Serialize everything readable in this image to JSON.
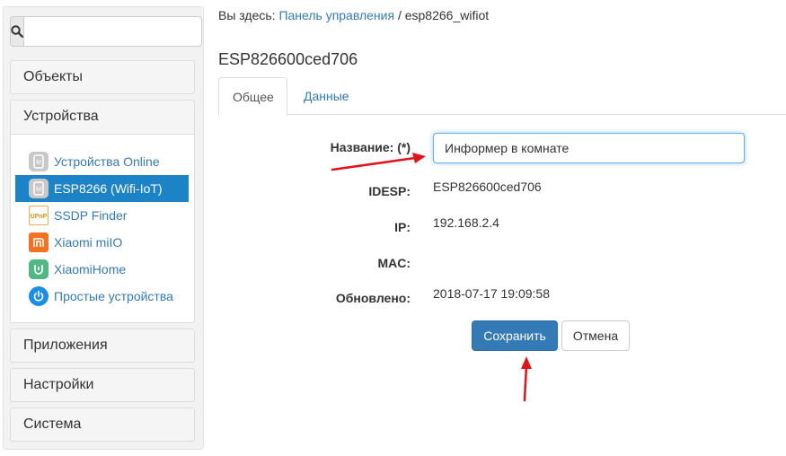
{
  "sidebar": {
    "search": {
      "placeholder": "",
      "value": ""
    },
    "panels": {
      "objects": "Объекты",
      "devices": "Устройства",
      "apps": "Приложения",
      "settings": "Настройки",
      "system": "Система"
    },
    "device_items": [
      {
        "label": "Устройства Online",
        "icon": "device-icon",
        "active": false
      },
      {
        "label": "ESP8266 (Wifi-IoT)",
        "icon": "device-icon",
        "active": true
      },
      {
        "label": "SSDP Finder",
        "icon": "upnp-icon",
        "active": false
      },
      {
        "label": "Xiaomi miIO",
        "icon": "mi-icon",
        "active": false
      },
      {
        "label": "XiaomiHome",
        "icon": "xiaomi-home-icon",
        "active": false
      },
      {
        "label": "Простые устройства",
        "icon": "power-icon",
        "active": false
      }
    ]
  },
  "breadcrumb": {
    "prefix": "Вы здесь: ",
    "link": "Панель управления",
    "separator": " / ",
    "current": "esp8266_wifiot"
  },
  "page_title": "ESP826600ced706",
  "tabs": {
    "general": "Общее",
    "data": "Данные"
  },
  "form": {
    "name_label": "Название: (*)",
    "name_value": "Информер в комнате",
    "idesp_label": "IDESP:",
    "idesp_value": "ESP826600ced706",
    "ip_label": "IP:",
    "ip_value": "192.168.2.4",
    "mac_label": "MAC:",
    "mac_value": "",
    "updated_label": "Обновлено:",
    "updated_value": "2018-07-17 19:09:58"
  },
  "buttons": {
    "save": "Сохранить",
    "cancel": "Отмена"
  },
  "colors": {
    "accent": "#337ab7",
    "active_menu": "#1c83c6",
    "annotation_arrow": "#e0141b"
  }
}
